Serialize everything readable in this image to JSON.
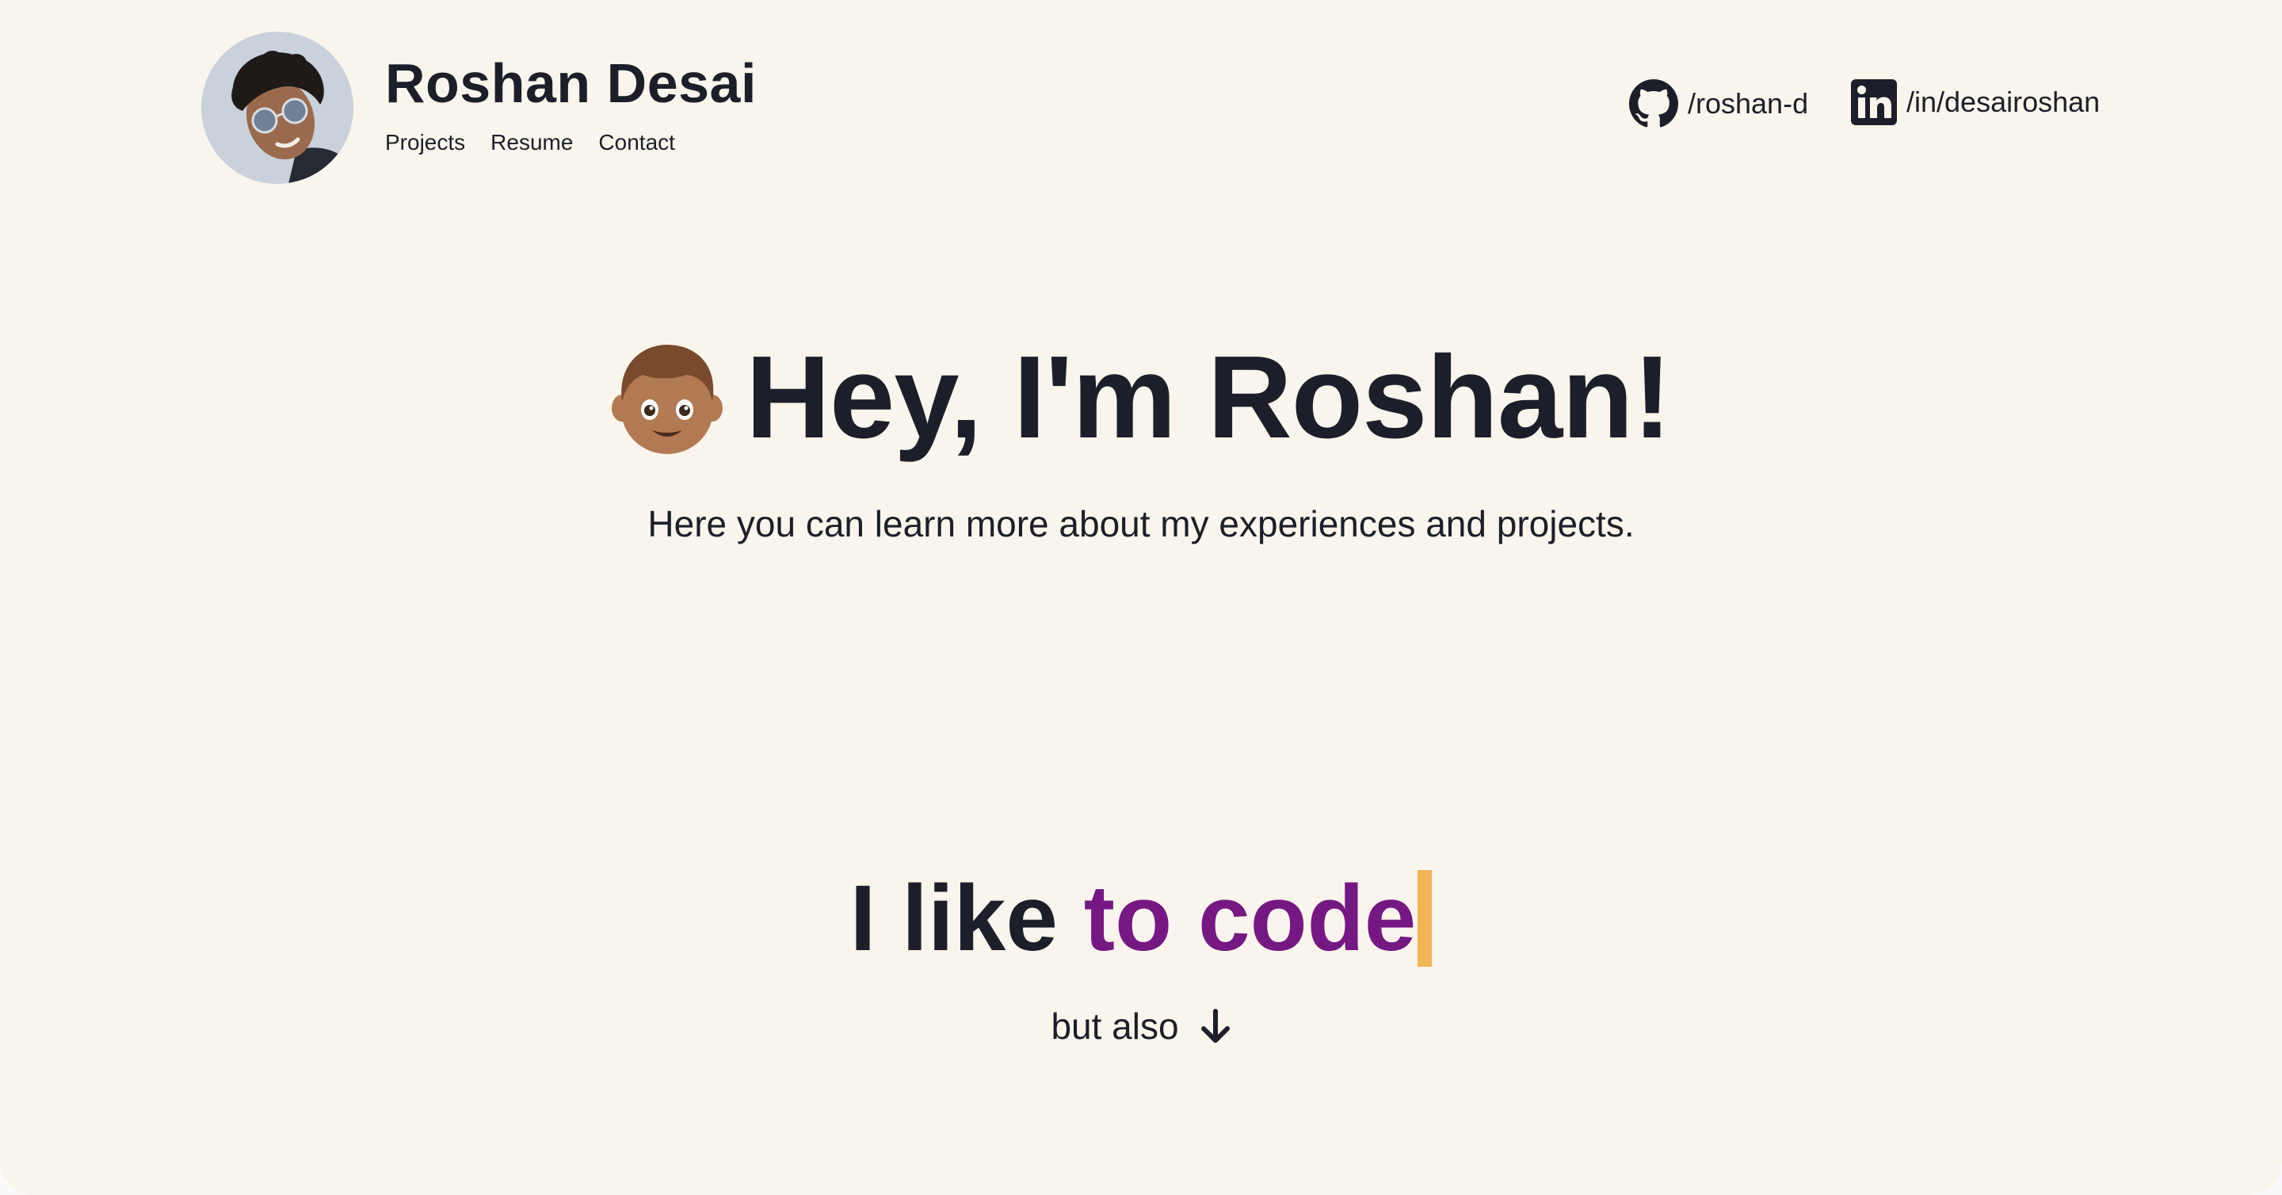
{
  "header": {
    "name": "Roshan Desai",
    "nav": [
      "Projects",
      "Resume",
      "Contact"
    ],
    "social": {
      "github": "/roshan-d",
      "linkedin": "/in/desairoshan"
    }
  },
  "hero": {
    "title": "Hey, I'm Roshan!",
    "subtitle": "Here you can learn more about my experiences and projects."
  },
  "typed": {
    "prefix": "I like ",
    "accent": "to code"
  },
  "cta": {
    "label": "but also"
  },
  "colors": {
    "background": "#f9f5ec",
    "text": "#1c1f2a",
    "accent": "#751883",
    "caret": "#f2b555"
  },
  "icons": [
    "avatar-photo",
    "github-icon",
    "linkedin-icon",
    "boy-emoji-icon",
    "arrow-down-icon"
  ]
}
